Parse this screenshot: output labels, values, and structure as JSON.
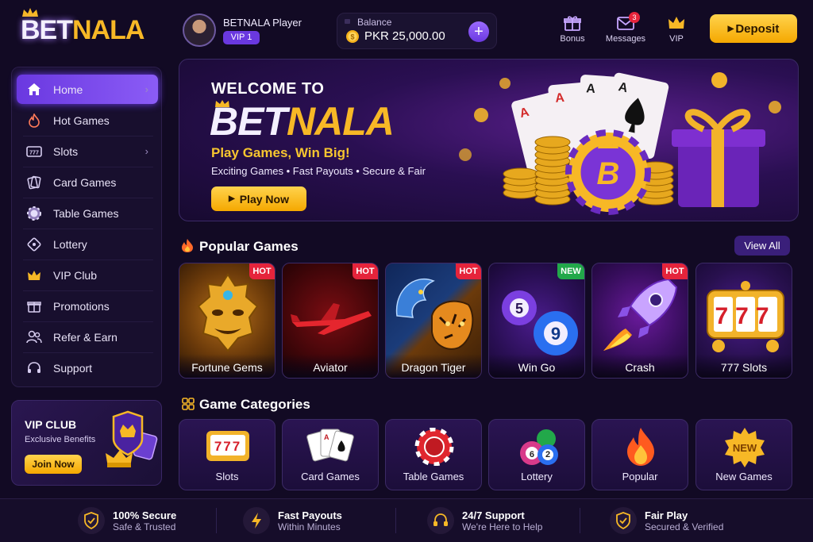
{
  "brand": {
    "part1": "BET",
    "part2": "NALA"
  },
  "player": {
    "name": "BETNALA Player",
    "level": "VIP 1"
  },
  "balance": {
    "label": "Balance",
    "amount": "PKR 25,000.00"
  },
  "top_nav": [
    {
      "label": "Bonus",
      "icon": "gift-icon"
    },
    {
      "label": "Messages",
      "icon": "envelope-icon",
      "badge": "3"
    },
    {
      "label": "VIP",
      "icon": "crown-icon"
    }
  ],
  "deposit_label": "Deposit",
  "sidebar": {
    "items": [
      {
        "label": "Home",
        "icon": "home-icon",
        "active": true,
        "chevron": true
      },
      {
        "label": "Hot Games",
        "icon": "fire-icon"
      },
      {
        "label": "Slots",
        "icon": "slot-machine-icon",
        "chevron": true
      },
      {
        "label": "Card Games",
        "icon": "cards-icon"
      },
      {
        "label": "Table Games",
        "icon": "chip-icon"
      },
      {
        "label": "Lottery",
        "icon": "ticket-icon"
      },
      {
        "label": "VIP Club",
        "icon": "crown-icon"
      },
      {
        "label": "Promotions",
        "icon": "gift-icon"
      },
      {
        "label": "Refer & Earn",
        "icon": "users-icon"
      },
      {
        "label": "Support",
        "icon": "headset-icon"
      }
    ]
  },
  "vip_card": {
    "title": "VIP CLUB",
    "subtitle": "Exclusive Benefits",
    "button": "Join Now"
  },
  "banner": {
    "welcome": "WELCOME TO",
    "brand1": "BET",
    "brand2": "NALA",
    "headline": "Play Games, Win Big!",
    "features": "Exciting Games • Fast Payouts • Secure & Fair",
    "cta": "Play Now"
  },
  "popular": {
    "title": "Popular Games",
    "view_all": "View All",
    "games": [
      {
        "name": "Fortune Gems",
        "tag": "HOT"
      },
      {
        "name": "Aviator",
        "tag": "HOT"
      },
      {
        "name": "Dragon Tiger",
        "tag": "HOT"
      },
      {
        "name": "Win Go",
        "tag": "NEW",
        "balls": [
          "5",
          "9"
        ]
      },
      {
        "name": "Crash",
        "tag": "HOT"
      },
      {
        "name": "777 Slots",
        "tag": "",
        "reels": "777"
      }
    ]
  },
  "categories": {
    "title": "Game Categories",
    "items": [
      {
        "label": "Slots",
        "art": "777"
      },
      {
        "label": "Card Games",
        "art": "A"
      },
      {
        "label": "Table Games",
        "art": ""
      },
      {
        "label": "Lottery",
        "art": "6 2"
      },
      {
        "label": "Popular",
        "art": ""
      },
      {
        "label": "New Games",
        "art": "NEW"
      }
    ]
  },
  "footer": [
    {
      "title": "100% Secure",
      "sub": "Safe & Trusted",
      "icon": "shield-check-icon"
    },
    {
      "title": "Fast Payouts",
      "sub": "Within Minutes",
      "icon": "lightning-icon"
    },
    {
      "title": "24/7 Support",
      "sub": "We're Here to Help",
      "icon": "headset-icon"
    },
    {
      "title": "Fair Play",
      "sub": "Secured & Verified",
      "icon": "shield-check-icon"
    }
  ],
  "colors": {
    "accent": "#8b5cf6",
    "gold": "#f7b826",
    "hot": "#e5243b",
    "new": "#22a84a",
    "background": "#120a24"
  }
}
